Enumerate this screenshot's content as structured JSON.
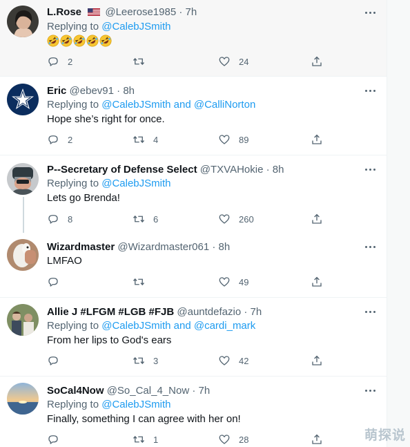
{
  "tweets": [
    {
      "display_name": "L.Rose",
      "handle": "@Leerose1985",
      "time": "7h",
      "replying_prefix": "Replying to",
      "mentions": [
        "@CalebJSmith"
      ],
      "mention_joiner": "",
      "text": "",
      "emoji_count": 5,
      "emoji_name": "rolling-on-floor-laughing",
      "counts": {
        "reply": "2",
        "retweet": "",
        "like": "24"
      },
      "highlighted": true
    },
    {
      "display_name": "Eric",
      "handle": "@ebev91",
      "time": "8h",
      "replying_prefix": "Replying to",
      "mentions": [
        "@CalebJSmith",
        "@CalliNorton"
      ],
      "mention_joiner": "and",
      "text": "Hope she’s right for once.",
      "counts": {
        "reply": "2",
        "retweet": "4",
        "like": "89"
      }
    },
    {
      "display_name": "P--Secretary of Defense Select",
      "handle": "@TXVAHokie",
      "time": "8h",
      "replying_prefix": "Replying to",
      "mentions": [
        "@CalebJSmith"
      ],
      "mention_joiner": "",
      "text": "Lets go Brenda!",
      "counts": {
        "reply": "8",
        "retweet": "6",
        "like": "260"
      }
    },
    {
      "display_name": "Wizardmaster",
      "handle": "@Wizardmaster061",
      "time": "8h",
      "text": "LMFAO",
      "counts": {
        "reply": "",
        "retweet": "",
        "like": "49"
      }
    },
    {
      "display_name": "Allie J #LFGM #LGB #FJB",
      "handle": "@auntdefazio",
      "time": "7h",
      "replying_prefix": "Replying to",
      "mentions": [
        "@CalebJSmith",
        "@cardi_mark"
      ],
      "mention_joiner": "and",
      "text": "From her lips to God's ears",
      "counts": {
        "reply": "",
        "retweet": "3",
        "like": "42"
      }
    },
    {
      "display_name": "SoCal4Now",
      "handle": "@So_Cal_4_Now",
      "time": "7h",
      "replying_prefix": "Replying to",
      "mentions": [
        "@CalebJSmith"
      ],
      "mention_joiner": "",
      "text": "Finally, something I can agree with her on!",
      "counts": {
        "reply": "",
        "retweet": "1",
        "like": "28"
      }
    }
  ],
  "separator_dot": "·",
  "watermark": "萌探说",
  "colors": {
    "accent": "#1d9bf0",
    "secondary_text": "#536471",
    "primary_text": "#0f1419",
    "border": "#eff3f4"
  },
  "icons": [
    "reply-icon",
    "retweet-icon",
    "like-icon",
    "share-icon",
    "more-icon",
    "us-flag-icon"
  ]
}
